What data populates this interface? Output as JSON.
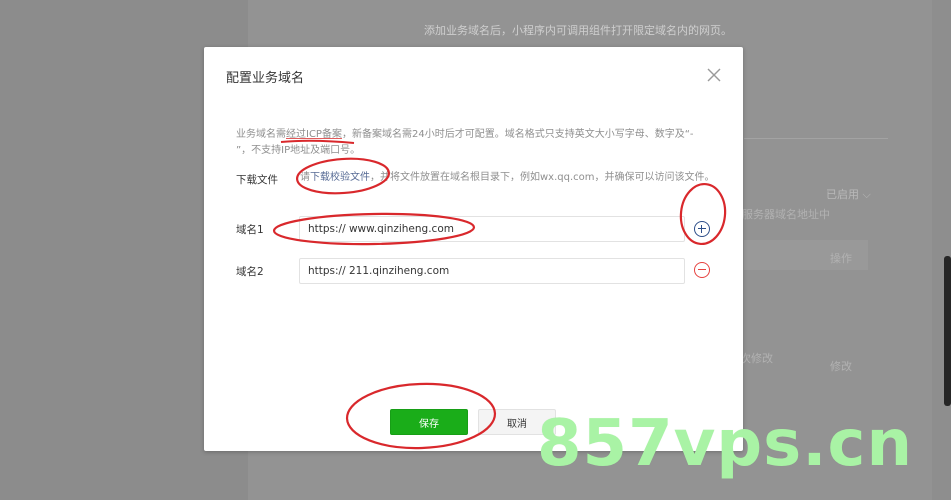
{
  "background": {
    "note": "添加业务域名后，小程序内可调用组件打开限定域名内的网页。",
    "status_label": "已启用 ⌵",
    "server_text": "服务器域名地址中",
    "operation_header": "操作",
    "edit_date_text": "次修改",
    "edit_link": "修改"
  },
  "dialog": {
    "title": "配置业务域名",
    "description_prefix": "业务域名需",
    "description_icp": "经过ICP备案",
    "description_rest": "，新备案域名需24小时后才可配置。域名格式只支持英文大小写字母、数字及“- ”，不支持IP地址及端口号。",
    "download_label": "下载文件",
    "download_prefix": "请",
    "download_link": "下载校验文件",
    "download_rest": "，并将文件放置在域名根目录下，例如wx.qq.com，并确保可以访问该文件。",
    "domains": [
      {
        "label": "域名1",
        "value": "https:// www.qinziheng.com"
      },
      {
        "label": "域名2",
        "value": "https:// 211.qinziheng.com"
      }
    ],
    "save_label": "保存",
    "cancel_label": "取消"
  },
  "icons": {
    "close": "close-icon",
    "add": "plus-circle-icon",
    "remove": "minus-circle-icon"
  },
  "watermark": "857vps.cn",
  "colors": {
    "primary": "#1aad19",
    "link": "#576b95",
    "danger": "#e64340",
    "annotation": "#d9282c",
    "watermark": "#a9f3a5"
  }
}
